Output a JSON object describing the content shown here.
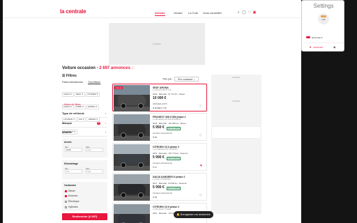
{
  "header": {
    "logo": "la centrale",
    "nav": [
      {
        "label": "Acheter",
        "active": true
      },
      {
        "label": "Vendre",
        "active": false
      },
      {
        "label": "La Cote",
        "active": false
      },
      {
        "label": "Vous conseiller",
        "active": false
      }
    ]
  },
  "ads": {
    "label": "Publicité"
  },
  "results": {
    "title_prefix": "Voiture occasion - ",
    "count": "2 697 annonces",
    "info": "ⓘ"
  },
  "filters": {
    "heading": "Filtres",
    "selected_label": "Filtres sélectionnés",
    "clear_label": "Tout effacer",
    "chips": [
      "DACIA ✕",
      "SEAT ✕",
      "CITROEN ✕",
      "DACIA ✕",
      "FORD ✕",
      "HONDA ✕",
      "HYUNDAI ✕",
      "KIA ✕",
      "NISSAN ✕",
      "PEUGEOT ✕"
    ],
    "less_label": "– Moins de filtres",
    "accordions": [
      {
        "label": "Type de véhicule",
        "badge": ""
      },
      {
        "label": "Marque",
        "badge": "10"
      },
      {
        "label": "Modèle",
        "badge": ""
      }
    ],
    "year": {
      "title": "Année",
      "min_label": "Min",
      "max_label": "Max",
      "min_value": "2015",
      "max_value": "Max"
    },
    "mileage": {
      "title": "Kilométrage",
      "min_label": "Min",
      "max_label": "Max",
      "min_value": "Min",
      "max_value": "Max"
    },
    "fuel": {
      "title": "Carburant",
      "options": [
        {
          "label": "Diesel",
          "checked": true
        },
        {
          "label": "Essence",
          "checked": true
        },
        {
          "label": "Électrique",
          "checked": false
        },
        {
          "label": "Hybrides",
          "checked": false
        }
      ]
    },
    "search_button": "Rechercher (2 697)"
  },
  "sort": {
    "label": "Trier par :",
    "value": "Prix croissant ⌄"
  },
  "listings": [
    {
      "ribbon": "À la une",
      "title": "SEAT ARONA",
      "subtitle": "1.0 ECOTSI 95 STYLE",
      "specs": "2018 · Manuelle · 97 714 km · Diesel",
      "price": "10 000 €",
      "tag": "",
      "seller": "GORGES AUTO",
      "dept": "ANNECY (74)",
      "fav": false,
      "car_color": "#4a4a4a",
      "sky": "#7a8a96"
    },
    {
      "ribbon": "",
      "title": "PEUGEOT 308 II SW phase 2",
      "subtitle": "1.6 BLUEHDI 120 S&S BUSINESS",
      "specs": "2018 · Manuelle · 161 000 km · Diesel",
      "price": "5 950 €",
      "tag": "Bon prix affiché",
      "seller": "Vendeur professionnel",
      "dept": "59",
      "fav": false,
      "car_color": "#2e2e2e",
      "sky": "#8e9aa4"
    },
    {
      "ribbon": "",
      "title": "CITROEN C3 II phase 2",
      "subtitle": "1.2 PURETECH 82 CONFORT",
      "specs": "2015 · Manuelle · 187 774 km · Essence",
      "price": "5 990 €",
      "tag": "Offre équilibrée",
      "seller": "Vendeur professionnel",
      "dept": "37",
      "fav": true,
      "car_color": "#3a3f45",
      "sky": "#a6b0b8"
    },
    {
      "ribbon": "",
      "title": "DACIA SANDERO II phase 2",
      "subtitle": "1.0 SCE 75 STEPWAY",
      "specs": "2017 · Manuelle · 84 000 km · Essence",
      "price": "5 990 €",
      "tag": "Bon prix affiché",
      "seller": "Vendeur professionnel",
      "dept": "59",
      "fav": false,
      "car_color": "#26282b",
      "sky": "#9aa3aa"
    },
    {
      "ribbon": "",
      "title": "CITROEN C3 II phase 2",
      "subtitle": "1.6 BLUEHDI 75 FEEL",
      "specs": "2016 · Manuelle · 170 000 km · Diesel",
      "price": "",
      "tag": "",
      "seller": "",
      "dept": "",
      "fav": false,
      "car_color": "#30343a",
      "sky": "#8c969e"
    }
  ],
  "save_search": "🔔 Enregistrer ma recherche",
  "popup": {
    "title": "Settings",
    "logo_text": "LCR",
    "site": "lacentrale.fr",
    "support": "SUPPORT",
    "toggle_on": true
  },
  "colors": {
    "brand": "#e8173d"
  }
}
